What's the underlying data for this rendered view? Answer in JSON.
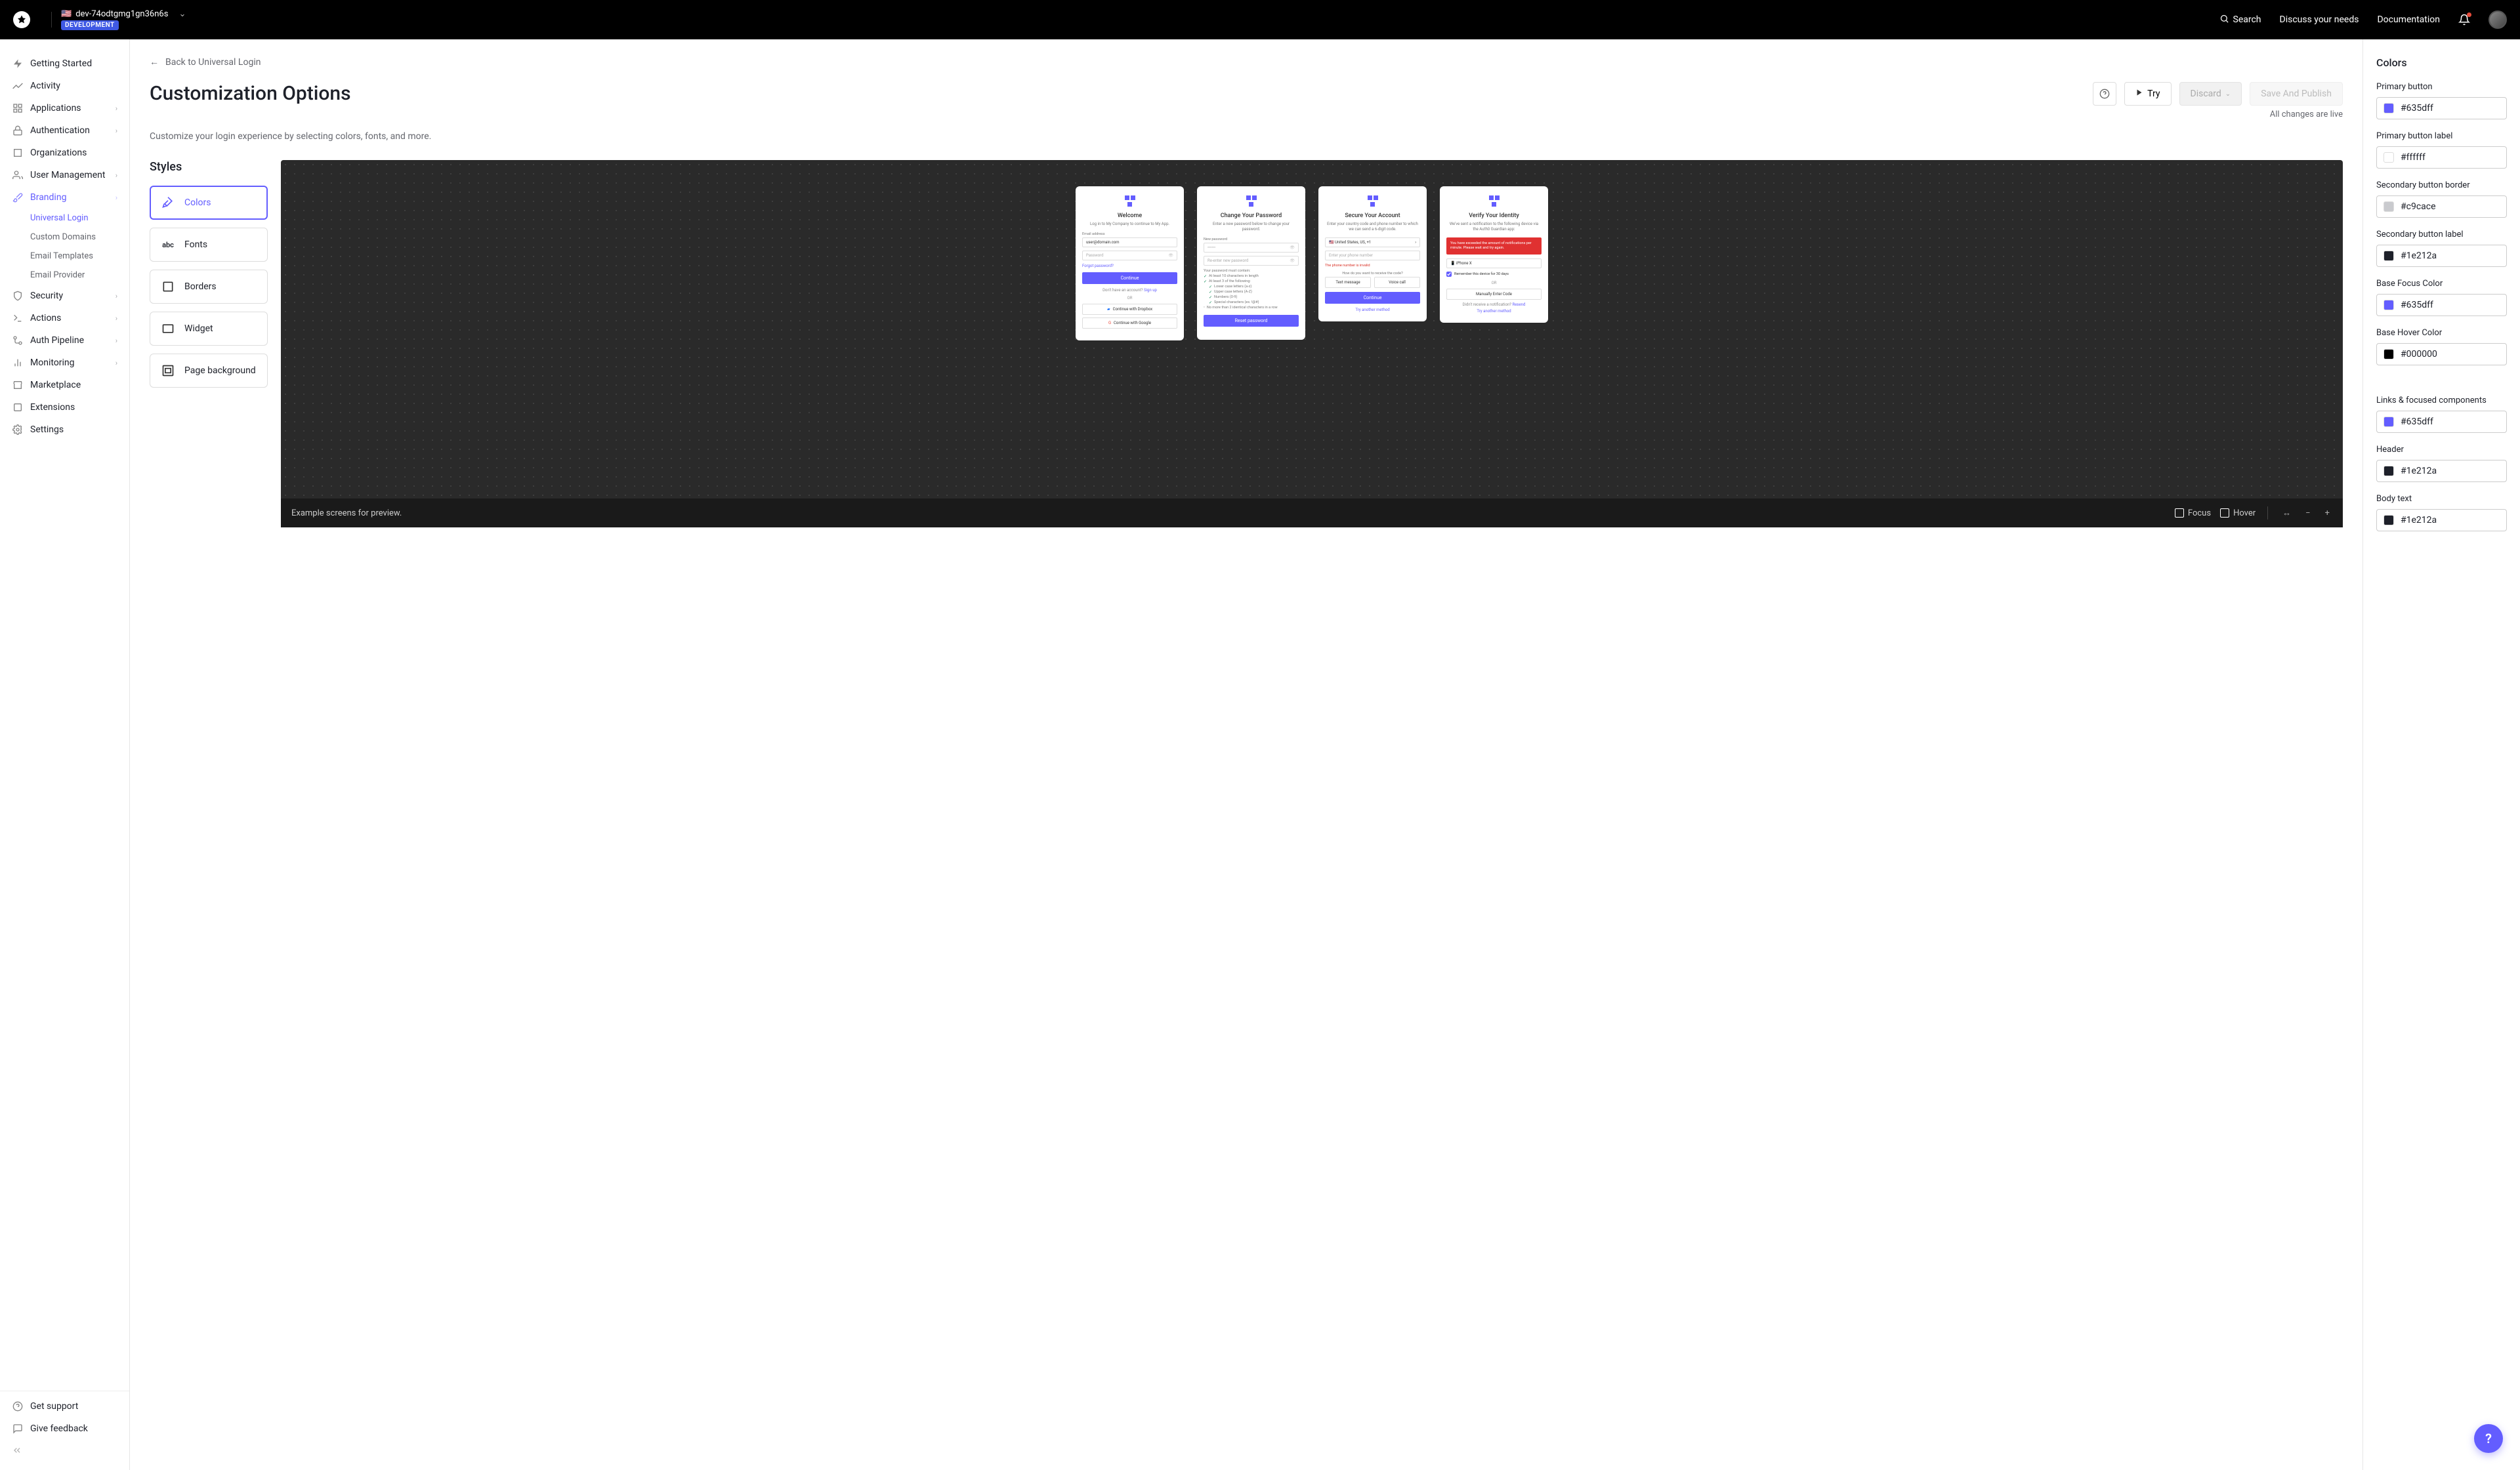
{
  "topbar": {
    "tenant_name": "dev-74odtgmg1gn36n6s",
    "tenant_badge": "DEVELOPMENT",
    "search": "Search",
    "discuss": "Discuss your needs",
    "docs": "Documentation"
  },
  "sidebar": {
    "items": [
      {
        "label": "Getting Started",
        "icon": "bolt",
        "expandable": false
      },
      {
        "label": "Activity",
        "icon": "chart",
        "expandable": false
      },
      {
        "label": "Applications",
        "icon": "apps",
        "expandable": true
      },
      {
        "label": "Authentication",
        "icon": "lock",
        "expandable": true
      },
      {
        "label": "Organizations",
        "icon": "org",
        "expandable": false
      },
      {
        "label": "User Management",
        "icon": "users",
        "expandable": true
      },
      {
        "label": "Branding",
        "icon": "brush",
        "expandable": true,
        "active": true,
        "sub": [
          {
            "label": "Universal Login",
            "active": true
          },
          {
            "label": "Custom Domains"
          },
          {
            "label": "Email Templates"
          },
          {
            "label": "Email Provider"
          }
        ]
      },
      {
        "label": "Security",
        "icon": "shield",
        "expandable": true
      },
      {
        "label": "Actions",
        "icon": "flow",
        "expandable": true
      },
      {
        "label": "Auth Pipeline",
        "icon": "pipeline",
        "expandable": true
      },
      {
        "label": "Monitoring",
        "icon": "bars",
        "expandable": true
      },
      {
        "label": "Marketplace",
        "icon": "store",
        "expandable": false
      },
      {
        "label": "Extensions",
        "icon": "puzzle",
        "expandable": false
      },
      {
        "label": "Settings",
        "icon": "gear",
        "expandable": false
      }
    ],
    "support": "Get support",
    "feedback": "Give feedback"
  },
  "header": {
    "back": "Back to Universal Login",
    "title": "Customization Options",
    "try": "Try",
    "discard": "Discard",
    "save": "Save And Publish",
    "changes_live": "All changes are live",
    "desc": "Customize your login experience by selecting colors, fonts, and more."
  },
  "styles": {
    "title": "Styles",
    "items": [
      {
        "label": "Colors",
        "active": true
      },
      {
        "label": "Fonts"
      },
      {
        "label": "Borders"
      },
      {
        "label": "Widget"
      },
      {
        "label": "Page background"
      }
    ]
  },
  "preview": {
    "footer_text": "Example screens for preview.",
    "focus": "Focus",
    "hover": "Hover",
    "screens": {
      "welcome": {
        "title": "Welcome",
        "sub": "Log in to My Company to continue to My App.",
        "email_label": "Email address",
        "email_value": "user@domain.com",
        "password_label": "Password",
        "forgot": "Forgot password?",
        "continue": "Continue",
        "noaccount": "Don't have an account?",
        "signup": "Sign up",
        "or": "OR",
        "dropbox": "Continue with Dropbox",
        "google": "Continue with Google"
      },
      "change_pw": {
        "title": "Change Your Password",
        "sub": "Enter a new password below to change your password.",
        "new_pw": "New password",
        "reenter": "Re-enter new password",
        "must": "Your password must contain:",
        "rules": [
          "At least 10 characters in length",
          "At least 3 of the following:",
          "Lower case letters (a-z)",
          "Upper case letters (A-Z)",
          "Numbers (0-9)",
          "Special characters (ex. !@#)",
          "No more than 2 identical characters in a row"
        ],
        "reset": "Reset password"
      },
      "secure": {
        "title": "Secure Your Account",
        "sub": "Enter your country code and phone number to which we can send a 6-digit code.",
        "country": "United States, US, +1",
        "phone_ph": "Enter your phone number",
        "error": "The phone number is invalid",
        "how": "How do you want to receive the code?",
        "text": "Text message",
        "voice": "Voice call",
        "continue": "Continue",
        "try_another": "Try another method"
      },
      "verify": {
        "title": "Verify Your Identity",
        "sub": "We've sent a notification to the following device via the Auth0 Guardian app:",
        "alert": "You have exceeded the amount of notifications per minute. Please wait and try again.",
        "device": "iPhone X",
        "remember": "Remember this device for 30 days",
        "or": "OR",
        "manual": "Manually Enter Code",
        "didnt": "Didn't receive a notification?",
        "resend": "Resend",
        "try_another": "Try another method"
      }
    }
  },
  "colors": {
    "title": "Colors",
    "fields": [
      {
        "label": "Primary button",
        "value": "#635dff",
        "swatch": "#635dff"
      },
      {
        "label": "Primary button label",
        "value": "#ffffff",
        "swatch": "#ffffff"
      },
      {
        "label": "Secondary button border",
        "value": "#c9cace",
        "swatch": "#c9cace"
      },
      {
        "label": "Secondary button label",
        "value": "#1e212a",
        "swatch": "#1e212a"
      },
      {
        "label": "Base Focus Color",
        "value": "#635dff",
        "swatch": "#635dff"
      },
      {
        "label": "Base Hover Color",
        "value": "#000000",
        "swatch": "#000000"
      }
    ],
    "fields2": [
      {
        "label": "Links & focused components",
        "value": "#635dff",
        "swatch": "#635dff"
      },
      {
        "label": "Header",
        "value": "#1e212a",
        "swatch": "#1e212a"
      },
      {
        "label": "Body text",
        "value": "#1e212a",
        "swatch": "#1e212a"
      }
    ]
  }
}
